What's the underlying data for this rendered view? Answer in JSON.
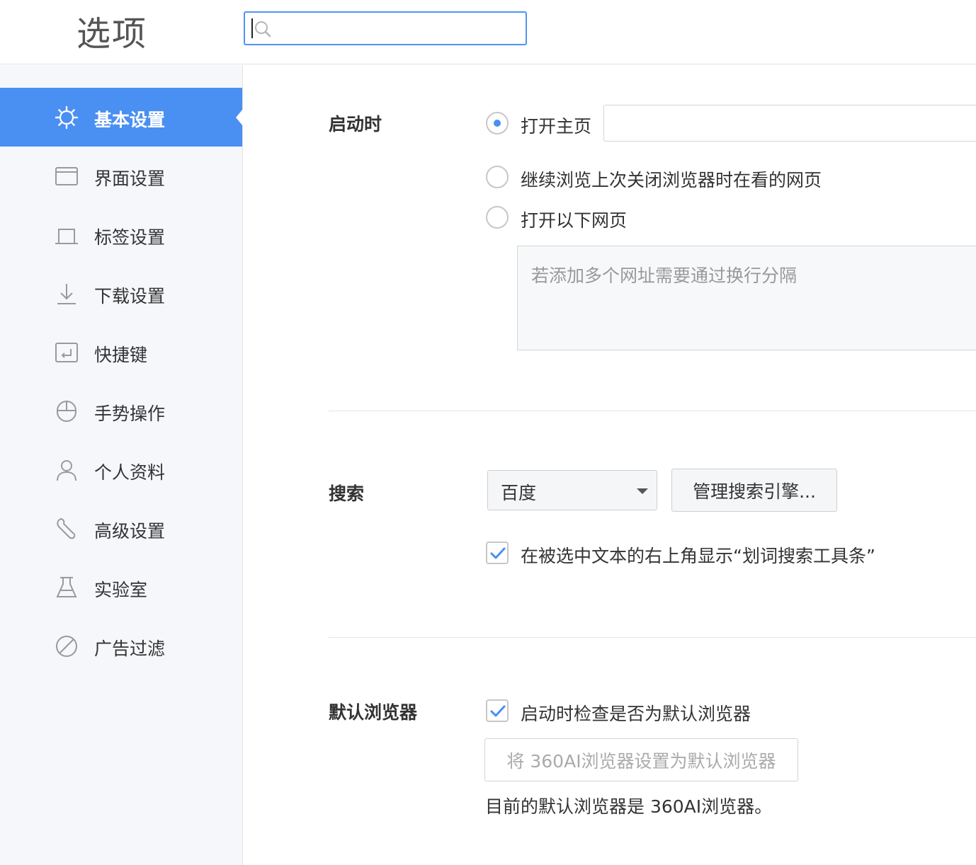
{
  "header": {
    "title": "选项",
    "search": {
      "value": "",
      "placeholder": ""
    }
  },
  "sidebar": {
    "items": [
      {
        "label": "基本设置",
        "icon": "gear-icon",
        "active": true
      },
      {
        "label": "界面设置",
        "icon": "window-icon",
        "active": false
      },
      {
        "label": "标签设置",
        "icon": "tab-icon",
        "active": false
      },
      {
        "label": "下载设置",
        "icon": "download-icon",
        "active": false
      },
      {
        "label": "快捷键",
        "icon": "shortcut-icon",
        "active": false
      },
      {
        "label": "手势操作",
        "icon": "mouse-icon",
        "active": false
      },
      {
        "label": "个人资料",
        "icon": "person-icon",
        "active": false
      },
      {
        "label": "高级设置",
        "icon": "wrench-icon",
        "active": false
      },
      {
        "label": "实验室",
        "icon": "flask-icon",
        "active": false
      },
      {
        "label": "广告过滤",
        "icon": "block-icon",
        "active": false
      }
    ]
  },
  "startup": {
    "label": "启动时",
    "option_home": "打开主页",
    "home_url": "",
    "option_continue": "继续浏览上次关闭浏览器时在看的网页",
    "option_pages": "打开以下网页",
    "pages_placeholder": "若添加多个网址需要通过换行分隔",
    "selected": "打开主页"
  },
  "search": {
    "label": "搜索",
    "engine": "百度",
    "manage_button": "管理搜索引擎...",
    "toolbar_option": "在被选中文本的右上角显示“划词搜索工具条”",
    "toolbar_checked": true
  },
  "default_browser": {
    "label": "默认浏览器",
    "check_option": "启动时检查是否为默认浏览器",
    "check_checked": true,
    "set_button": "将 360AI浏览器设置为默认浏览器",
    "status": "目前的默认浏览器是 360AI浏览器。"
  },
  "colors": {
    "accent": "#4a8ff2",
    "sidebar_bg": "#f5f7fb"
  }
}
